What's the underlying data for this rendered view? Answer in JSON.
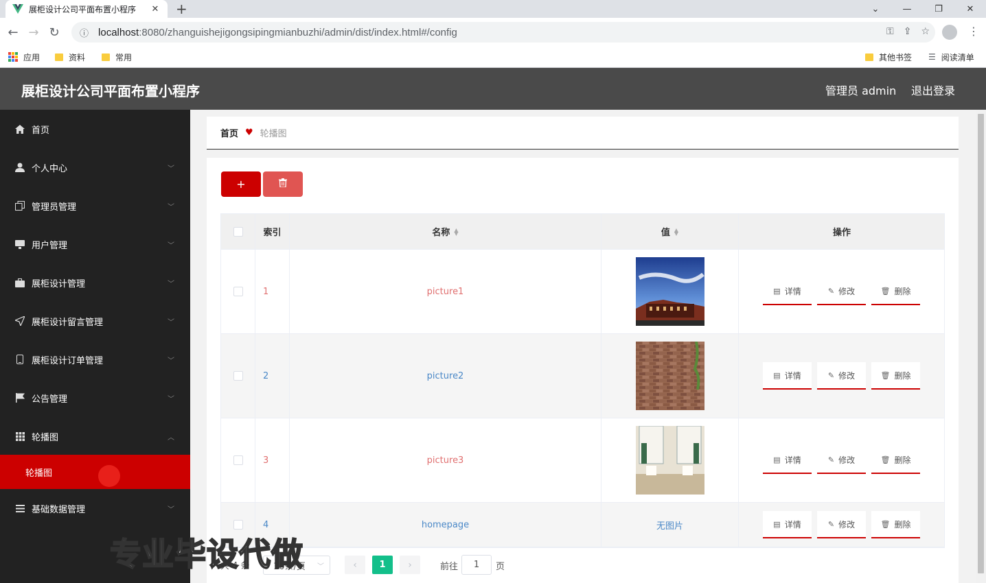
{
  "browser": {
    "tab_title": "展柜设计公司平面布置小程序",
    "tab_close": "✕",
    "new_tab": "+",
    "url_host": "localhost",
    "url_path": ":8080/zhanguishejigongsipingmianbuzhi/admin/dist/index.html#/config",
    "bookmarks": [
      {
        "label": "应用"
      },
      {
        "label": "资料"
      },
      {
        "label": "常用"
      }
    ],
    "bookmarks_right": [
      {
        "label": "其他书签"
      },
      {
        "label": "阅读清单"
      }
    ]
  },
  "header": {
    "title": "展柜设计公司平面布置小程序",
    "user": "管理员 admin",
    "logout": "退出登录"
  },
  "sidebar": {
    "items": [
      {
        "label": "首页",
        "icon": "home-icon"
      },
      {
        "label": "个人中心",
        "icon": "user-icon"
      },
      {
        "label": "管理员管理",
        "icon": "copy-icon"
      },
      {
        "label": "用户管理",
        "icon": "monitor-icon"
      },
      {
        "label": "展柜设计管理",
        "icon": "briefcase-icon"
      },
      {
        "label": "展柜设计留言管理",
        "icon": "send-icon"
      },
      {
        "label": "展柜设计订单管理",
        "icon": "phone-icon"
      },
      {
        "label": "公告管理",
        "icon": "flag-icon"
      },
      {
        "label": "轮播图",
        "icon": "grid-icon"
      },
      {
        "label": "基础数据管理",
        "icon": "menu-icon"
      }
    ],
    "active_sub": "轮播图"
  },
  "breadcrumb": {
    "home": "首页",
    "current": "轮播图"
  },
  "toolbar": {
    "add": "+"
  },
  "table": {
    "headers": {
      "index": "索引",
      "name": "名称",
      "value": "值",
      "actions": "操作"
    },
    "rows": [
      {
        "index": "1",
        "name": "picture1",
        "value_type": "image",
        "image": "building"
      },
      {
        "index": "2",
        "name": "picture2",
        "value_type": "image",
        "image": "brick"
      },
      {
        "index": "3",
        "name": "picture3",
        "value_type": "image",
        "image": "room"
      },
      {
        "index": "4",
        "name": "homepage",
        "value_type": "text",
        "value": "无图片"
      }
    ],
    "actions": {
      "detail": "详情",
      "edit": "修改",
      "delete": "删除"
    }
  },
  "pagination": {
    "total": "共 4 条",
    "page_size": "10条/页",
    "current": "1",
    "goto_label": "前往",
    "goto_value": "1",
    "page_label": "页"
  },
  "watermark": "专业毕设代做",
  "colors": {
    "accent": "#cc0000",
    "header": "#4a4a4a",
    "sidebar": "#222222",
    "pager_active": "#13bf8a"
  }
}
